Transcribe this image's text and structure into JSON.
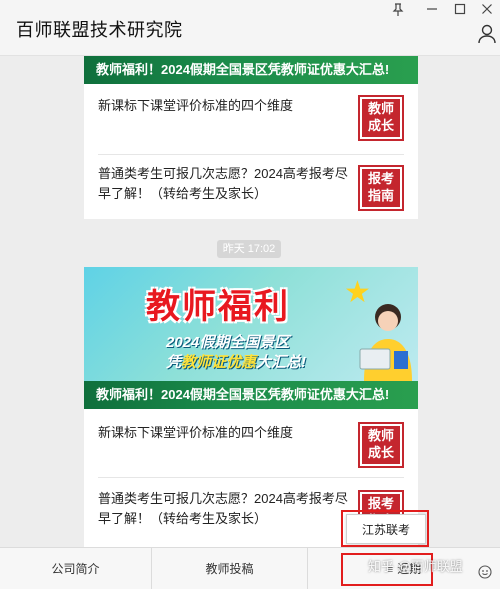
{
  "window": {
    "title": "百师联盟技术研究院"
  },
  "cards": {
    "card1": {
      "banner": "教师福利！2024假期全国景区凭教师证优惠大汇总!",
      "rows": [
        {
          "text": "新课标下课堂评价标准的四个维度",
          "thumb": "教师成长"
        },
        {
          "text": "普通类考生可报几次志愿？2024高考报考尽早了解！（转给考生及家长）",
          "thumb": "报考指南"
        }
      ]
    },
    "time": "昨天 17:02",
    "card2": {
      "hero_title": "教师福利",
      "hero_line1": "2024假期全国景区",
      "hero_line2_prefix": "凭",
      "hero_line2_highlight": "教师证优惠",
      "hero_line2_suffix": "大汇总!",
      "banner": "教师福利！2024假期全国景区凭教师证优惠大汇总!",
      "rows": [
        {
          "text": "新课标下课堂评价标准的四个维度",
          "thumb": "教师成长"
        },
        {
          "text": "普通类考生可报几次志愿？2024高考报考尽早了解！（转给考生及家长）",
          "thumb": "报考指南"
        }
      ]
    }
  },
  "menu": {
    "items": [
      "公司简介",
      "教师投稿",
      "近期"
    ],
    "popup": "江苏联考"
  },
  "watermark": "知乎 @百师联盟",
  "colors": {
    "accent_red": "#e21d1d",
    "banner_green": "#1a8a4a",
    "thumb_red": "#c4262e"
  }
}
